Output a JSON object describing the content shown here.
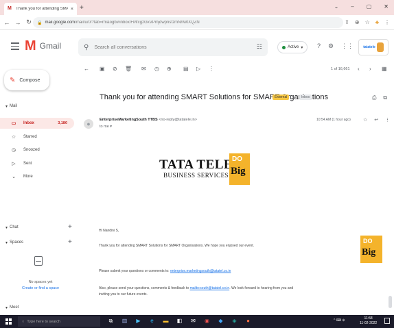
{
  "browser": {
    "tab_title": "Thank you for attending SMART",
    "tab_close": "×",
    "new_tab": "+",
    "url_host": "mail.google.com",
    "url_path": "/mail/u/0/?tab=rm&ogbl#inbox/FMfcgzGkVPmjdwpnsfzmNhWtXQZN",
    "window_controls": [
      "⌄",
      "–",
      "▢",
      "✕"
    ]
  },
  "gmail": {
    "brand": "Gmail",
    "search_placeholder": "Search all conversations",
    "status": "Active",
    "status_caret": "▾",
    "brand_widget": "tatatele"
  },
  "sidebar": {
    "compose": "Compose",
    "mail_label": "Mail",
    "items": [
      {
        "label": "Inbox",
        "count": "3,180",
        "icon": "inbox-icon"
      },
      {
        "label": "Starred",
        "count": "",
        "icon": "star-icon"
      },
      {
        "label": "Snoozed",
        "count": "",
        "icon": "clock-icon"
      },
      {
        "label": "Sent",
        "count": "",
        "icon": "send-icon"
      },
      {
        "label": "More",
        "count": "",
        "icon": "chevron-down-icon"
      }
    ],
    "chat_label": "Chat",
    "spaces_label": "Spaces",
    "no_spaces": "No spaces yet",
    "create_space": "Create or find a space",
    "meet_label": "Meet"
  },
  "toolbar": {
    "pager": "1 of 16,661"
  },
  "email": {
    "subject": "Thank you for attending SMART Solutions for SMART Organisations",
    "label_external": "External",
    "label_inbox": "Inbox",
    "sender_name": "EnterpriseMarketingSouth TTBS",
    "sender_email": "<no-reply@tatatele.in>",
    "to": "to me",
    "time": "10:54 AM (1 hour ago)",
    "logo_line1": "TATA TELE",
    "logo_line2": "BUSINESS SERVICES",
    "logo_do": "DO",
    "logo_big": "Big",
    "greeting": "Hi Nandini S,",
    "para1": "Thank you for attending SMART Solutions for SMART Organisations. We hope you enjoyed our event.",
    "para2_text": "Please submit your questions or comments to: ",
    "para2_link": "enterprise.marketingsouth@tatatel.co.in",
    "para3_text": "Also, please send your questions, comments & feedback to ",
    "para3_link": "mailto:south@tatatel.co.in",
    "para3_tail": ". We look forward to hearing from you and",
    "para3_line2": "inviting you to our future events."
  },
  "taskbar": {
    "search_placeholder": "Type here to search",
    "time": "11:58",
    "date": "11-02-2022",
    "tray": "^ ⌨ ⊕"
  }
}
